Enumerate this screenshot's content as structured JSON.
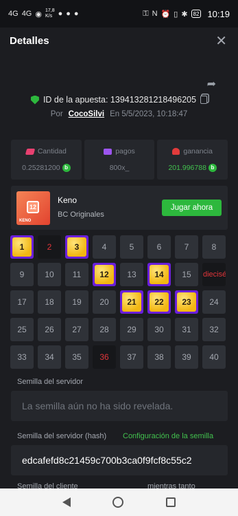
{
  "status_bar": {
    "network": "4G",
    "network2": "4G",
    "speed_value": "17,8",
    "speed_unit": "K/s",
    "battery": "82",
    "time": "10:19"
  },
  "header": {
    "title": "Detalles"
  },
  "bet": {
    "id_text": "ID de la apuesta: 139413281218496205",
    "by_label": "Por",
    "user": "CocoSilvi",
    "date_text": "En  5/5/2023, 10:18:47"
  },
  "stats": [
    {
      "label": "Cantidad",
      "value": "0.25281200",
      "icon": "hand-coins-icon"
    },
    {
      "label": "pagos",
      "value": "800x_",
      "icon": "wallet-icon"
    },
    {
      "label": "ganancia",
      "value": "201.996788",
      "icon": "user-icon"
    }
  ],
  "game": {
    "name": "Keno",
    "provider": "BC Originales",
    "thumb_number": "12",
    "thumb_brand": "KENO",
    "play_label": "Jugar ahora"
  },
  "keno": {
    "cells": [
      {
        "n": "1",
        "state": "hit"
      },
      {
        "n": "2",
        "state": "miss"
      },
      {
        "n": "3",
        "state": "hit"
      },
      {
        "n": "4",
        "state": "none"
      },
      {
        "n": "5",
        "state": "none"
      },
      {
        "n": "6",
        "state": "none"
      },
      {
        "n": "7",
        "state": "none"
      },
      {
        "n": "8",
        "state": "none"
      },
      {
        "n": "9",
        "state": "none"
      },
      {
        "n": "10",
        "state": "none"
      },
      {
        "n": "11",
        "state": "none"
      },
      {
        "n": "12",
        "state": "hit"
      },
      {
        "n": "13",
        "state": "none"
      },
      {
        "n": "14",
        "state": "hit"
      },
      {
        "n": "15",
        "state": "none"
      },
      {
        "n": "dieciséi",
        "state": "miss"
      },
      {
        "n": "17",
        "state": "none"
      },
      {
        "n": "18",
        "state": "none"
      },
      {
        "n": "19",
        "state": "none"
      },
      {
        "n": "20",
        "state": "none"
      },
      {
        "n": "21",
        "state": "hit"
      },
      {
        "n": "22",
        "state": "hit"
      },
      {
        "n": "23",
        "state": "hit"
      },
      {
        "n": "24",
        "state": "none"
      },
      {
        "n": "25",
        "state": "none"
      },
      {
        "n": "26",
        "state": "none"
      },
      {
        "n": "27",
        "state": "none"
      },
      {
        "n": "28",
        "state": "none"
      },
      {
        "n": "29",
        "state": "none"
      },
      {
        "n": "30",
        "state": "none"
      },
      {
        "n": "31",
        "state": "none"
      },
      {
        "n": "32",
        "state": "none"
      },
      {
        "n": "33",
        "state": "none"
      },
      {
        "n": "34",
        "state": "none"
      },
      {
        "n": "35",
        "state": "none"
      },
      {
        "n": "36",
        "state": "miss"
      },
      {
        "n": "37",
        "state": "none"
      },
      {
        "n": "38",
        "state": "none"
      },
      {
        "n": "39",
        "state": "none"
      },
      {
        "n": "40",
        "state": "none"
      }
    ]
  },
  "server_seed": {
    "label": "Semilla del servidor",
    "value": "La semilla aún no ha sido revelada."
  },
  "server_hash": {
    "label": "Semilla del servidor (hash)",
    "config_link": "Configuración de la semilla",
    "value": "edcafefd8c21459c700b3ca0f9fcf8c55c2"
  },
  "client_seed": {
    "label": "Semilla del cliente",
    "label2": "mientras tanto"
  },
  "colors": {
    "accent_green": "#2db83d",
    "hit_purple": "#6a1fdb",
    "miss_red": "#e0353a",
    "gem_yellow": "#f2b712"
  }
}
